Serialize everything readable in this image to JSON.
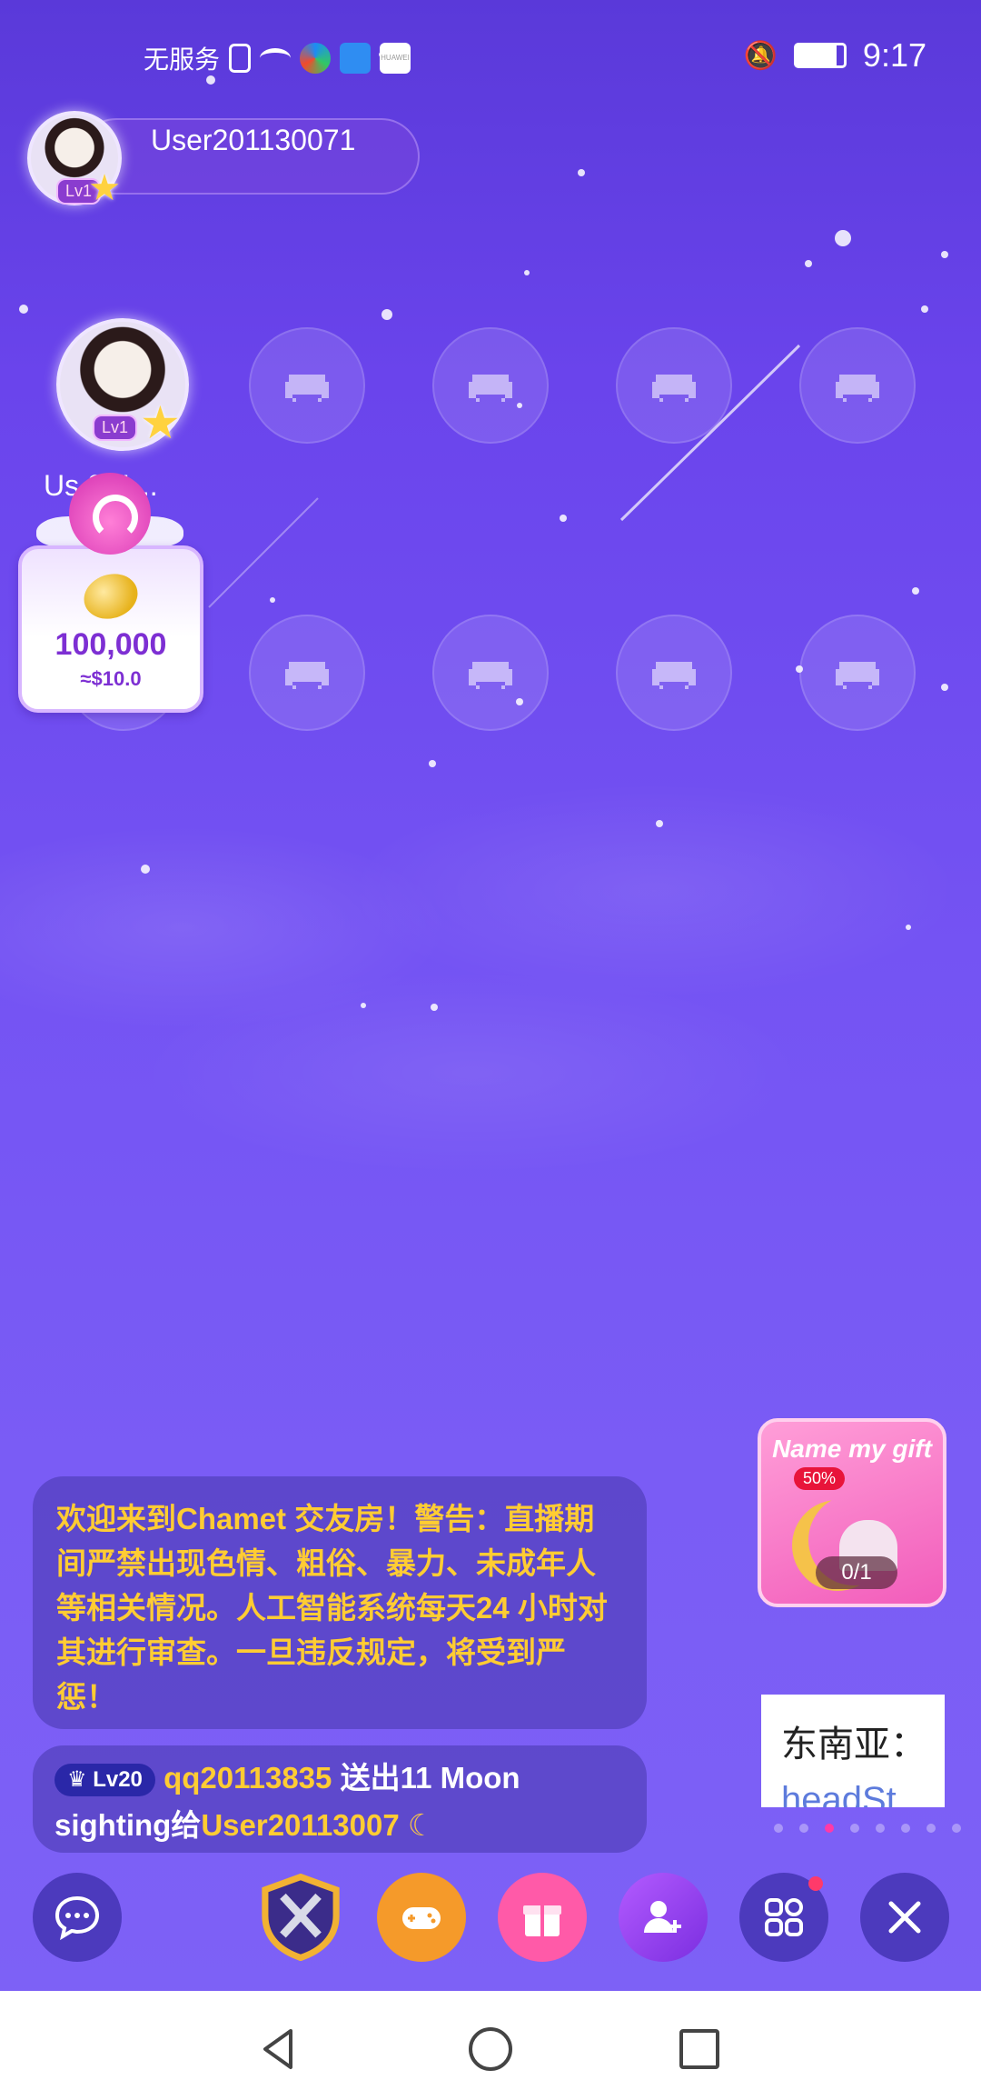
{
  "status_bar": {
    "carrier": "无服务",
    "time": "9:17",
    "icons": [
      "sim-alert-icon",
      "wifi-icon",
      "browser-icon",
      "vpn-icon",
      "huawei-icon",
      "bell-off-icon",
      "battery-icon"
    ],
    "huawei_label": "HUAWEI"
  },
  "host": {
    "name": "User201130071",
    "level": "Lv1"
  },
  "seats": {
    "occupied_name": "Us  011...",
    "occupied_level": "Lv1",
    "empty_icon": "sofa-icon"
  },
  "coin_reward": {
    "amount": "100,000",
    "usd": "≈$10.0"
  },
  "chat": {
    "notice": "欢迎来到Chamet 交友房！警告：直播期间严禁出现色情、粗俗、暴力、未成年人等相关情况。人工智能系统每天24 小时对其进行审查。一旦违反规定，将受到严惩！",
    "gift_level": "Lv20",
    "gift_sender": "qq20113835",
    "gift_text": "送出11 Moon sighting给",
    "gift_receiver": "User20113007"
  },
  "promo": {
    "title": "Name my gift",
    "discount": "50%",
    "progress": "0/1"
  },
  "banner": {
    "line1": "东南亚：",
    "line2": "headSt"
  },
  "bottom_bar": {
    "buttons": [
      "chat-icon",
      "battle-shield-icon",
      "game-controller-icon",
      "gift-icon",
      "add-user-icon",
      "apps-grid-icon",
      "close-icon"
    ]
  },
  "colors": {
    "accent": "#ff3aa7",
    "notice_text": "#ffcc33",
    "background_top": "#5a39d9",
    "background_bottom": "#7e62f6"
  }
}
